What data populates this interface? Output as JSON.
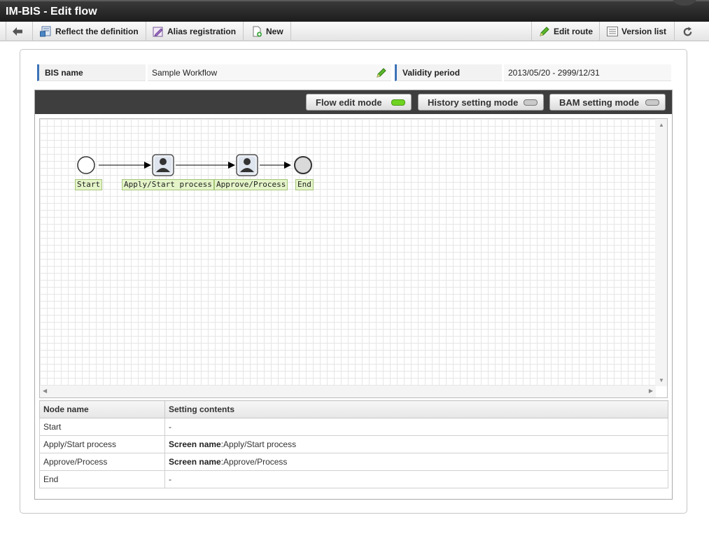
{
  "window": {
    "title": "IM-BIS - Edit flow"
  },
  "toolbar": {
    "back_icon": "arrow-left-icon",
    "reflect_label": "Reflect the definition",
    "alias_label": "Alias registration",
    "new_label": "New",
    "edit_route_label": "Edit route",
    "version_list_label": "Version list",
    "refresh_icon": "refresh-icon"
  },
  "info": {
    "bis_name_label": "BIS name",
    "bis_name_value": "Sample Workflow",
    "validity_label": "Validity period",
    "validity_value": "2013/05/20 - 2999/12/31"
  },
  "modes": {
    "flow_edit": "Flow edit mode",
    "history_setting": "History setting mode",
    "bam_setting": "BAM setting mode",
    "active": "flow_edit"
  },
  "flow": {
    "nodes": [
      {
        "id": "start",
        "type": "start",
        "label": "Start"
      },
      {
        "id": "apply",
        "type": "user-task",
        "label": "Apply/Start process"
      },
      {
        "id": "approve",
        "type": "user-task",
        "label": "Approve/Process"
      },
      {
        "id": "end",
        "type": "end",
        "label": "End"
      }
    ]
  },
  "settings_table": {
    "headers": [
      "Node name",
      "Setting contents"
    ],
    "rows": [
      {
        "node": "Start",
        "bold": "",
        "content": "-"
      },
      {
        "node": "Apply/Start process",
        "bold": "Screen name",
        "content": ":Apply/Start process"
      },
      {
        "node": "Approve/Process",
        "bold": "Screen name",
        "content": ":Approve/Process"
      },
      {
        "node": "End",
        "bold": "",
        "content": "-"
      }
    ]
  },
  "colors": {
    "titlebar": "#2a2a2a",
    "accent_blue": "#3c73b8",
    "led_on": "#6fd321",
    "node_label_bg": "#e4f4c8"
  }
}
